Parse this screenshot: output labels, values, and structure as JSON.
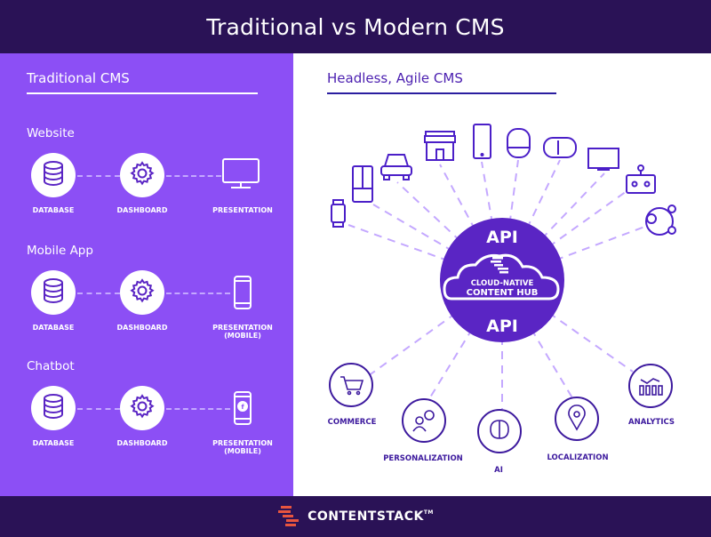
{
  "header": {
    "title": "Traditional vs Modern CMS"
  },
  "colors": {
    "header_bg": "#2a1256",
    "left_bg": "#8c4ff5",
    "accent": "#5a25c4",
    "dash": "#c4a8ff",
    "brand_red": "#e8553f"
  },
  "traditional": {
    "title": "Traditional CMS",
    "rows": [
      {
        "title": "Website",
        "nodes": [
          "DATABASE",
          "DASHBOARD"
        ],
        "presentation": "PRESENTATION",
        "presentation_sub": "",
        "presentation_icon": "monitor-icon"
      },
      {
        "title": "Mobile App",
        "nodes": [
          "DATABASE",
          "DASHBOARD"
        ],
        "presentation": "PRESENTATION",
        "presentation_sub": "(MOBILE)",
        "presentation_icon": "smartphone-icon"
      },
      {
        "title": "Chatbot",
        "nodes": [
          "DATABASE",
          "DASHBOARD"
        ],
        "presentation": "PRESENTATION",
        "presentation_sub": "(MOBILE)",
        "presentation_icon": "smartphone-facebook-icon"
      }
    ]
  },
  "modern": {
    "title": "Headless, Agile CMS",
    "hub": {
      "api_top": "API",
      "line1": "CLOUD-NATIVE",
      "line2": "CONTENT HUB",
      "api_bottom": "API"
    },
    "devices": [
      "smartwatch",
      "refrigerator",
      "car",
      "storefront",
      "smartphone",
      "smart-speaker",
      "vr-headset",
      "tv",
      "robot",
      "social-network"
    ],
    "capabilities": [
      {
        "label": "COMMERCE",
        "icon": "shopping-cart-icon"
      },
      {
        "label": "PERSONALIZATION",
        "icon": "user-gear-icon"
      },
      {
        "label": "AI",
        "icon": "brain-icon"
      },
      {
        "label": "LOCALIZATION",
        "icon": "map-pin-icon"
      },
      {
        "label": "ANALYTICS",
        "icon": "analytics-chart-icon"
      }
    ]
  },
  "footer": {
    "brand": "CONTENTSTACK",
    "tm": "TM"
  }
}
